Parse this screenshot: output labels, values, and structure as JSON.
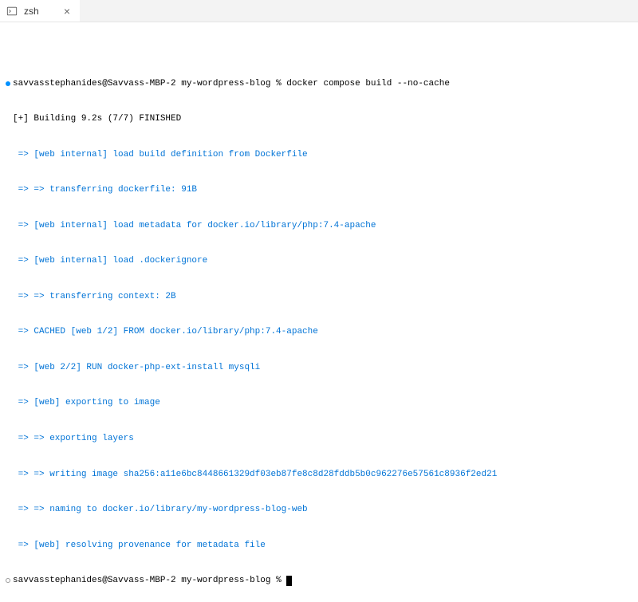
{
  "tab": {
    "label": "zsh"
  },
  "prompt1": {
    "userhost": "savvasstephanides@Savvass-MBP-2",
    "dir": "my-wordpress-blog",
    "symbol": "%",
    "command": "docker compose build --no-cache"
  },
  "build": {
    "header": "[+] Building 9.2s (7/7) FINISHED",
    "lines": [
      " => [web internal] load build definition from Dockerfile",
      " => => transferring dockerfile: 91B",
      " => [web internal] load metadata for docker.io/library/php:7.4-apache",
      " => [web internal] load .dockerignore",
      " => => transferring context: 2B",
      " => CACHED [web 1/2] FROM docker.io/library/php:7.4-apache",
      " => [web 2/2] RUN docker-php-ext-install mysqli",
      " => [web] exporting to image",
      " => => exporting layers",
      " => => writing image sha256:a11e6bc8448661329df03eb87fe8c8d28fddb5b0c962276e57561c8936f2ed21",
      " => => naming to docker.io/library/my-wordpress-blog-web",
      " => [web] resolving provenance for metadata file"
    ]
  },
  "prompt2": {
    "userhost": "savvasstephanides@Savvass-MBP-2",
    "dir": "my-wordpress-blog",
    "symbol": "%"
  }
}
